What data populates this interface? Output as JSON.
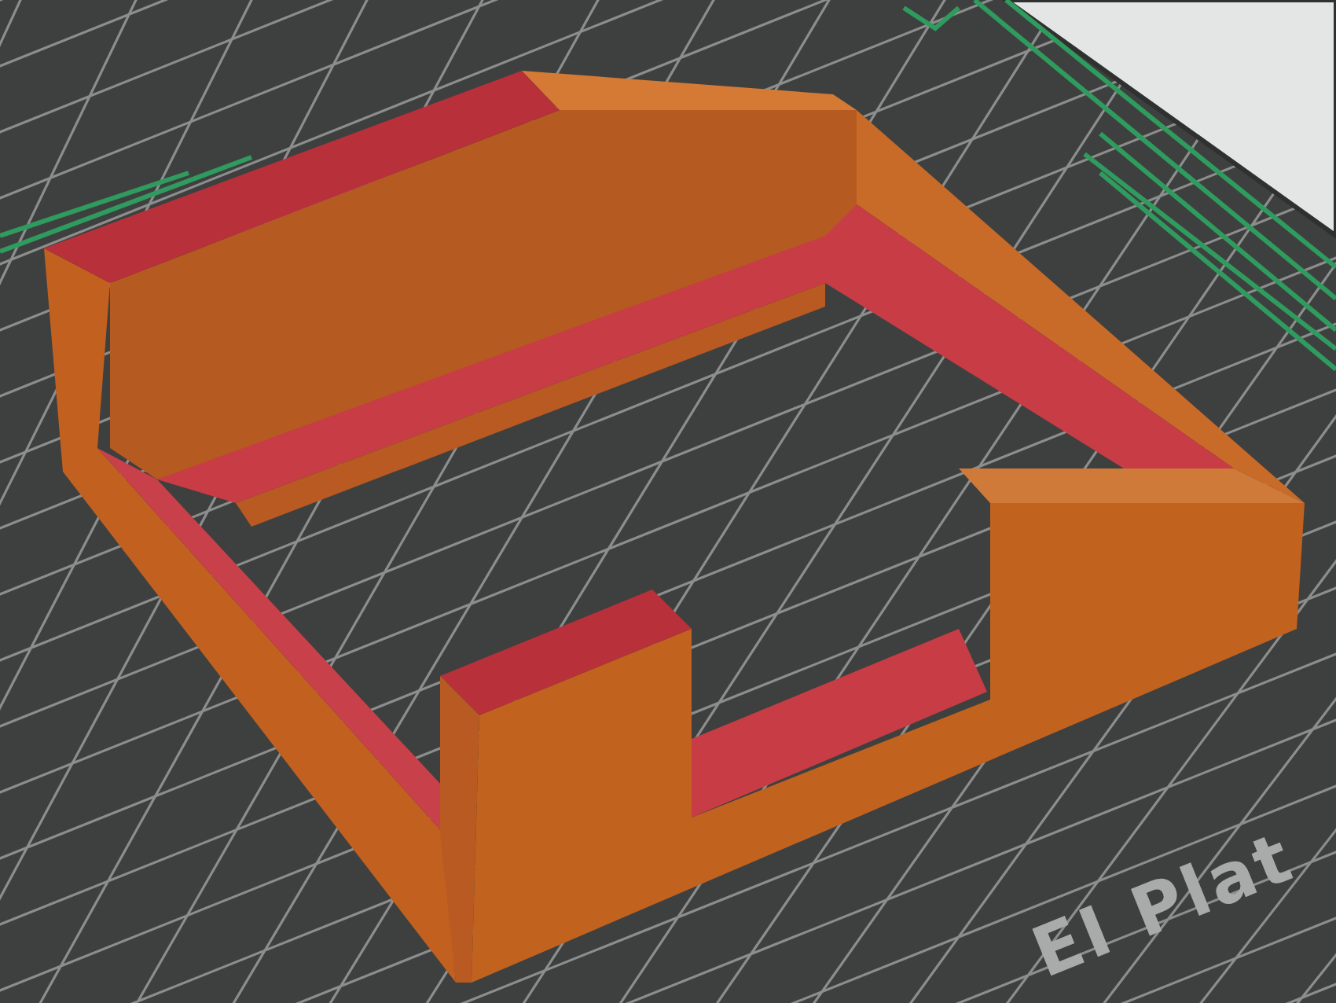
{
  "viewport": {
    "bed_label": "EI Plat"
  }
}
